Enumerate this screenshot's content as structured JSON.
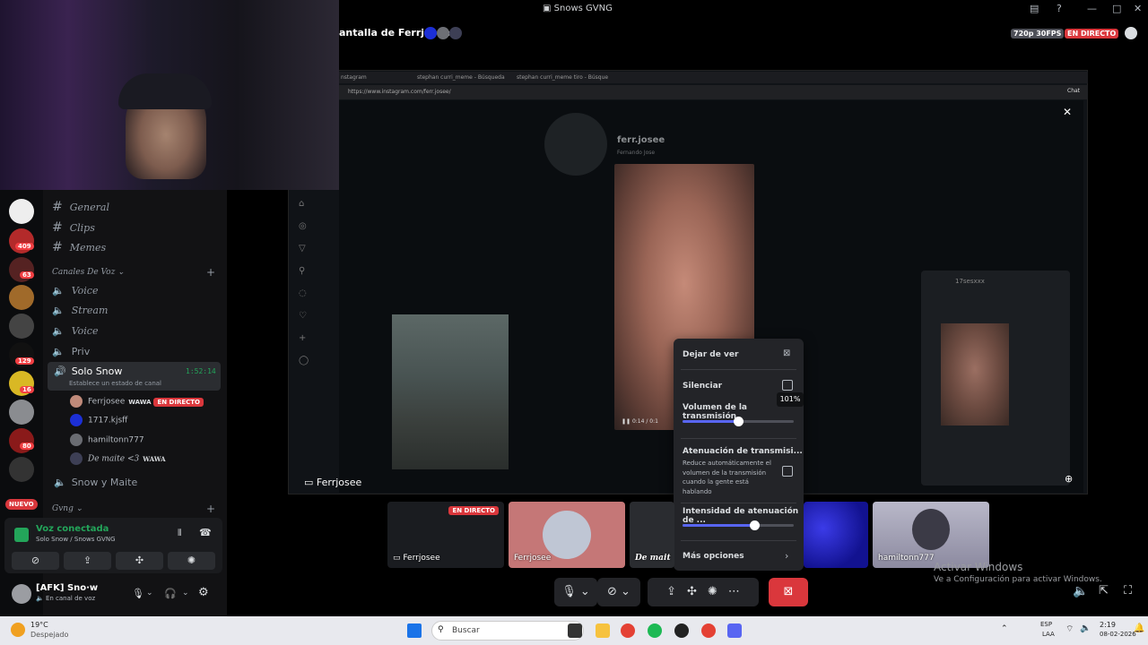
{
  "window": {
    "title": "Snows GVNG"
  },
  "stream": {
    "title": "antalla de Ferrjosee",
    "quality": "720p 30FPS",
    "live_badge": "EN DIRECTO",
    "label": "Ferrjosee"
  },
  "browser": {
    "tabs": [
      "nstagram",
      "stephan curri_meme - Búsqueda",
      "stephan curri_meme tiro - Búsque"
    ],
    "url": "https://www.instagram.com/ferr.josee/",
    "chat_btn": "Chat",
    "profile_name": "ferr.josee",
    "profile_sub": "Fernando Jose",
    "chat_user": "17sesxxx",
    "video_time": "0:14 / 0:1"
  },
  "channels": {
    "text": [
      {
        "label": "General"
      },
      {
        "label": "Clips"
      },
      {
        "label": "Memes"
      }
    ],
    "voice_header": "Canales De Voz",
    "voice": [
      {
        "label": "Voice"
      },
      {
        "label": "Stream"
      },
      {
        "label": "Voice"
      },
      {
        "label": "Priv"
      }
    ],
    "active": {
      "label": "Solo Snow",
      "timer": "1:52:14",
      "status": "Establece un estado de canal"
    },
    "users": [
      {
        "name": "Ferrjosee",
        "tag": "WAWA",
        "live": "EN DIRECTO"
      },
      {
        "name": "1717.kjsff"
      },
      {
        "name": "hamiltonn777"
      },
      {
        "name": "De maite <3",
        "tag": "WAWA"
      }
    ],
    "after": {
      "label": "Snow y Maite"
    },
    "group": "Gvng"
  },
  "servers": {
    "badges": [
      "409",
      "63",
      "129",
      "16",
      "80"
    ],
    "new_label": "NUEVO"
  },
  "voice_panel": {
    "status": "Voz conectada",
    "location": "Solo Snow / Snows GVNG"
  },
  "user_panel": {
    "name": "[AFK] Sno·w",
    "status": "En canal de voz"
  },
  "popup": {
    "stop": "Dejar de ver",
    "mute": "Silenciar",
    "volume_label": "Volumen de la transmisión",
    "volume_tooltip": "101%",
    "attenuation_title": "Atenuación de transmisi...",
    "attenuation_desc": "Reduce automáticamente el volumen de la transmisión cuando la gente está hablando",
    "intensity_label": "Intensidad de atenuación de ...",
    "more": "Más opciones"
  },
  "tiles": [
    {
      "label": "Ferrjosee",
      "badge": "EN DIRECTO"
    },
    {
      "label": "Ferrjosee"
    },
    {
      "label": "De mait"
    },
    {
      "label": ""
    },
    {
      "label": "hamiltonn777"
    }
  ],
  "activate": {
    "title": "Activar Windows",
    "sub": "Ve a Configuración para activar Windows."
  },
  "taskbar": {
    "weather_temp": "19°C",
    "weather_desc": "Despejado",
    "search": "Buscar",
    "lang1": "ESP",
    "lang2": "LAA",
    "time": "2:19",
    "date": "08-02-2026"
  },
  "colors": {
    "accent": "#5865f2",
    "live": "#da373c",
    "green": "#23a55a"
  }
}
